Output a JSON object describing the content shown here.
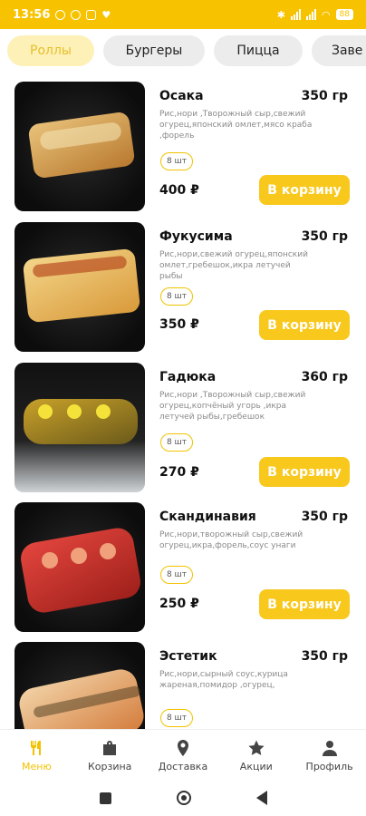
{
  "status": {
    "time": "13:56",
    "battery": "88"
  },
  "tabs": [
    {
      "label": "Роллы",
      "active": true
    },
    {
      "label": "Бургеры"
    },
    {
      "label": "Пицца"
    },
    {
      "label": "Заве"
    }
  ],
  "products": [
    {
      "name": "Осака",
      "weight": "350 гр",
      "desc": "Рис,нори ,Творожный сыр,свежий огурец,японский омлет,мясо краба ,форель",
      "qty": "8 шт",
      "price": "400 ₽",
      "button": "В корзину"
    },
    {
      "name": "Фукусима",
      "weight": "350 гр",
      "desc": "Рис,нори,свежий огурец,японский омлет,гребешок,икра летучей рыбы",
      "qty": "8 шт",
      "price": "350 ₽",
      "button": "В корзину"
    },
    {
      "name": "Гадюка",
      "weight": "360 гр",
      "desc": "Рис,нори ,Творожный сыр,свежий огурец,копчёный угорь ,икра летучей рыбы,гребешок",
      "qty": "8 шт",
      "price": "270 ₽",
      "button": "В корзину"
    },
    {
      "name": "Скандинавия",
      "weight": "350 гр",
      "desc": "Рис,нори,творожный сыр,свежий огурец,икра,форель,соус унаги",
      "qty": "8 шт",
      "price": "250 ₽",
      "button": "В корзину"
    },
    {
      "name": "Эстетик",
      "weight": "350 гр",
      "desc": "Рис,нори,сырный соус,курица жареная,помидор ,огурец,",
      "qty": "8 шт"
    }
  ],
  "nav": [
    {
      "label": "Меню",
      "icon": "cutlery-icon",
      "active": true
    },
    {
      "label": "Корзина",
      "icon": "bag-icon"
    },
    {
      "label": "Доставка",
      "icon": "location-pin-icon"
    },
    {
      "label": "Акции",
      "icon": "star-icon"
    },
    {
      "label": "Профиль",
      "icon": "person-icon"
    }
  ],
  "colors": {
    "accent": "#f8c81c",
    "statusbar": "#f7c300"
  }
}
